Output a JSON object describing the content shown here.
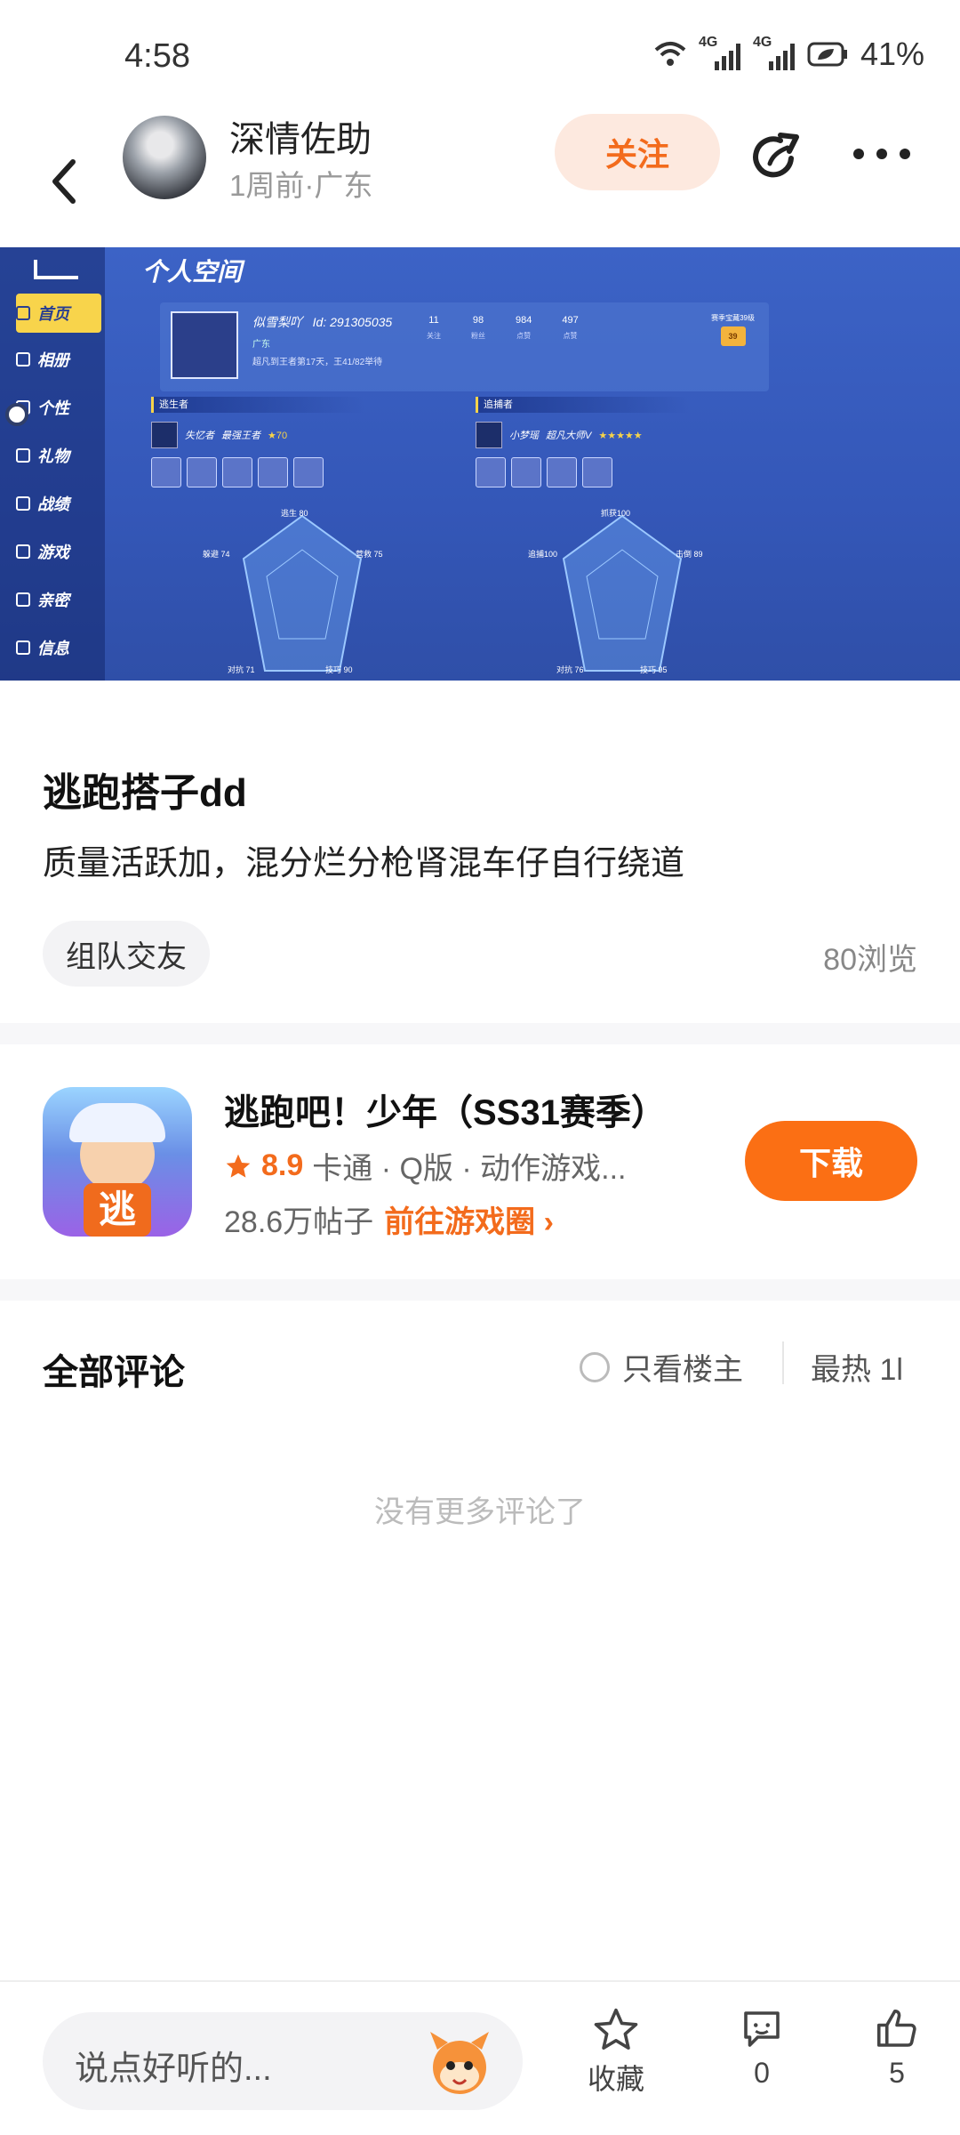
{
  "status": {
    "time": "4:58",
    "net1": "4G",
    "net2": "4G",
    "battery": "41%"
  },
  "header": {
    "author": "深情佐助",
    "meta": "1周前·广东",
    "follow_label": "关注"
  },
  "screenshot": {
    "page_title": "个人空间",
    "sidebar": [
      "首页",
      "相册",
      "个性",
      "礼物",
      "战绩",
      "游戏",
      "亲密",
      "信息"
    ],
    "player_name": "似雪梨吖",
    "player_id": "Id: 291305035",
    "player_region": "广东",
    "player_note": "超凡到王者第17天，王41/82举待",
    "stats": [
      {
        "value": "11",
        "label": "关注"
      },
      {
        "value": "98",
        "label": "粉丝"
      },
      {
        "value": "984",
        "label": "点赞"
      },
      {
        "value": "497",
        "label": "点赞"
      }
    ],
    "season_label": "赛季宝藏39级",
    "season_badge": "39",
    "runner": {
      "tag": "逃生者",
      "hero": "失忆者",
      "rank": "最强王者",
      "stars": "★70",
      "radar": {
        "top": "逃生 80",
        "left": "躲避 74",
        "right": "营救 75",
        "bl": "对抗 71",
        "br": "技巧 90"
      }
    },
    "chaser": {
      "tag": "追捕者",
      "hero": "小梦瑶",
      "rank": "超凡大师V",
      "stars": "★★★★★",
      "radar": {
        "top": "抓获100",
        "left": "追捕100",
        "right": "击倒 89",
        "bl": "对抗 76",
        "br": "技巧 95"
      }
    }
  },
  "post": {
    "title": "逃跑搭子dd",
    "body": "质量活跃加，混分烂分枪肾混车仔自行绕道",
    "tag": "组队交友",
    "views": "80浏览"
  },
  "game": {
    "icon_text": "逃",
    "name": "逃跑吧！少年（SS31赛季）",
    "score": "8.9",
    "genres": "卡通 · Q版 · 动作游戏...",
    "posts": "28.6万帖子",
    "go_label": "前往游戏圈",
    "download_label": "下载",
    "accent": "#fb6f14"
  },
  "comments": {
    "title": "全部评论",
    "owner_only": "只看楼主",
    "sort": "最热",
    "sort_more": "1l",
    "empty": "没有更多评论了"
  },
  "bottom": {
    "input_placeholder": "说点好听的...",
    "collect_label": "收藏",
    "comment_count": "0",
    "like_count": "5"
  }
}
